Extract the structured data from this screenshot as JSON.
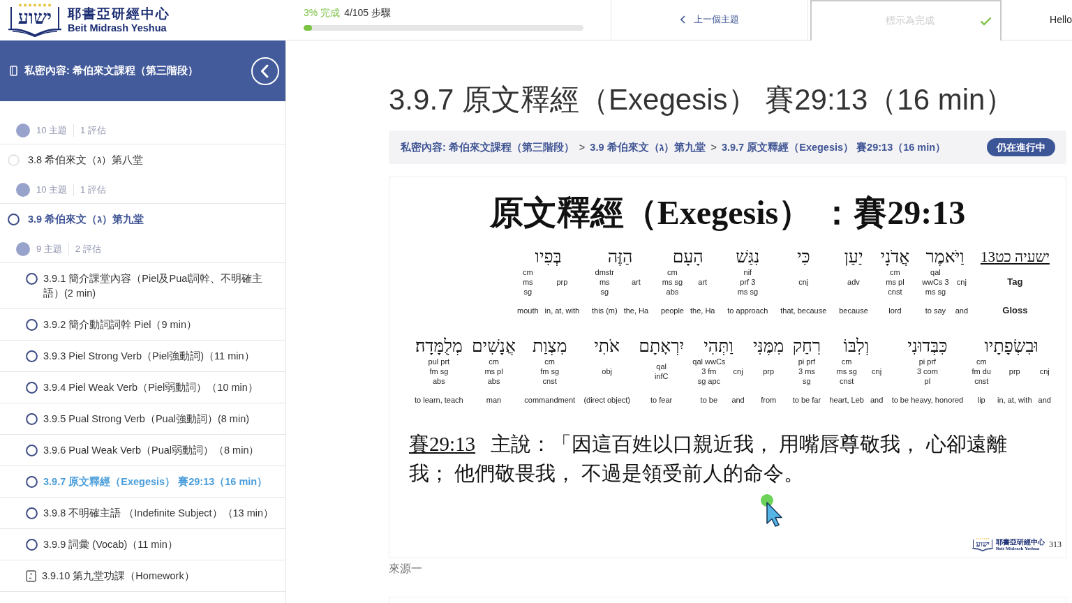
{
  "logo": {
    "mark": "ישוע",
    "name": "耶書亞研經中心",
    "subtitle": "Beit Midrash Yeshua"
  },
  "topbar": {
    "progress": {
      "percent": "3% 完成",
      "steps": "4/105 步驟",
      "level": 0.03
    },
    "prev_button": {
      "label": "上一個主題"
    },
    "complete_button": {
      "label": "標示為完成",
      "disabled": true
    },
    "user": {
      "greeting": "Hello"
    }
  },
  "sidebar": {
    "header": {
      "title": "私密內容: 希伯來文課程（第三階段）"
    },
    "lessons": [
      {
        "topics_count": "10 主題",
        "assessments_count": "1 評估"
      },
      {
        "title": "3.8 希伯來文（ג）第八堂",
        "selected": false,
        "topics_count": "10 主題",
        "assessments_count": "1 評估"
      },
      {
        "title": "3.9 希伯來文（ג）第九堂",
        "selected": true,
        "topics_count": "9 主題",
        "assessments_count": "2 評估",
        "topics": [
          {
            "kind": "lesson",
            "label": "3.9.1 簡介課堂內容（Piel及Pual詞幹、不明確主語）(2 min)",
            "selected": false
          },
          {
            "kind": "lesson",
            "label": "3.9.2 簡介動詞詞幹 Piel（9 min）",
            "selected": false
          },
          {
            "kind": "lesson",
            "label": "3.9.3 Piel Strong Verb（Piel強動詞)（11 min）",
            "selected": false
          },
          {
            "kind": "lesson",
            "label": "3.9.4 Piel Weak Verb（Piel弱動詞）（10 min）",
            "selected": false
          },
          {
            "kind": "lesson",
            "label": "3.9.5 Pual Strong Verb（Pual強動詞）(8 min)",
            "selected": false
          },
          {
            "kind": "lesson",
            "label": "3.9.6 Pual Weak Verb（Pual弱動詞）（8 min）",
            "selected": false
          },
          {
            "kind": "lesson",
            "label": "3.9.7 原文釋經（Exegesis） 賽29:13（16 min）",
            "selected": true
          },
          {
            "kind": "lesson",
            "label": "3.9.8 不明確主語 （Indefinite Subject）（13 min）",
            "selected": false
          },
          {
            "kind": "lesson",
            "label": "3.9.9 詞彙 (Vocab)（11 min）",
            "selected": false
          },
          {
            "kind": "homework",
            "label": "3.9.10 第九堂功課（Homework）",
            "selected": false
          }
        ]
      }
    ]
  },
  "main": {
    "title": "3.9.7 原文釋經（Exegesis） 賽29:13（16 min）",
    "breadcrumbs": [
      {
        "kind": "link",
        "label": "私密內容: 希伯來文課程（第三階段）"
      },
      {
        "kind": "separator",
        "label": ">"
      },
      {
        "kind": "link",
        "label": "3.9 希伯來文（ג）第九堂"
      },
      {
        "kind": "separator",
        "label": ">"
      },
      {
        "kind": "link",
        "label": "3.9.7 原文釋經（Exegesis） 賽29:13（16 min）"
      }
    ],
    "status_badge": "仍在進行中",
    "slide": {
      "title": "原文釋經（Exegesis） ：賽29:13",
      "interlinear": [
        {
          "label": {
            "reference": "ישעיה כט13",
            "tag": "Tag",
            "gloss": "Gloss"
          },
          "hebrew": [
            "וַיֹּאמֶר",
            "אֲדֹנָי",
            "יַעַן",
            "כִּי",
            "נִגַּשׁ",
            "הָעָם",
            "הַזֶּה",
            "בְּפִיו"
          ],
          "words": [
            {
              "parts": [
                {
                  "tag": [
                    "cm",
                    "ms",
                    "sg"
                  ],
                  "gloss": "mouth"
                },
                {
                  "tag": [
                    "prp"
                  ],
                  "gloss": "in, at, with"
                }
              ]
            },
            {
              "parts": [
                {
                  "tag": [
                    "dmstr",
                    "ms",
                    "sg"
                  ],
                  "gloss": "this (m)"
                },
                {
                  "tag": [
                    "art"
                  ],
                  "gloss": "the, Ha"
                }
              ]
            },
            {
              "parts": [
                {
                  "tag": [
                    "cm",
                    "ms sg",
                    "abs"
                  ],
                  "gloss": "people"
                },
                {
                  "tag": [
                    "art"
                  ],
                  "gloss": "the, Ha"
                }
              ]
            },
            {
              "parts": [
                {
                  "tag": [
                    "nif",
                    "prf 3",
                    "ms sg"
                  ],
                  "gloss": "to approach"
                }
              ]
            },
            {
              "parts": [
                {
                  "tag": [
                    "cnj"
                  ],
                  "gloss": "that, because"
                }
              ]
            },
            {
              "parts": [
                {
                  "tag": [
                    "adv"
                  ],
                  "gloss": "because"
                }
              ]
            },
            {
              "parts": [
                {
                  "tag": [
                    "cm",
                    "ms pl",
                    "cnst"
                  ],
                  "gloss": "lord"
                }
              ]
            },
            {
              "parts": [
                {
                  "tag": [
                    "qal",
                    "wwCs 3",
                    "ms sg"
                  ],
                  "gloss": "to say"
                },
                {
                  "tag": [
                    "cnj"
                  ],
                  "gloss": "and"
                }
              ]
            }
          ]
        },
        {
          "hebrew": [
            "וּבִשְׂפָתָיו",
            "כִּבְּדוּנִי",
            "וְלִבּוֹ",
            "רִחַק",
            "מִמֶּנִּי",
            "וַתְּהִי",
            "יִרְאָתָם",
            "אֹתִי",
            "מִצְוַת",
            "אֲנָשִׁים",
            "מְלֻמָּדָה׃"
          ],
          "words": [
            {
              "parts": [
                {
                  "tag": [
                    "pul prt",
                    "fm sg",
                    "abs"
                  ],
                  "gloss": "to learn, teach"
                }
              ]
            },
            {
              "parts": [
                {
                  "tag": [
                    "cm",
                    "ms pl",
                    "abs"
                  ],
                  "gloss": "man"
                }
              ]
            },
            {
              "parts": [
                {
                  "tag": [
                    "cm",
                    "fm sg",
                    "cnst"
                  ],
                  "gloss": "commandment"
                }
              ]
            },
            {
              "parts": [
                {
                  "tag": [
                    "obj"
                  ],
                  "gloss": "(direct object)"
                }
              ]
            },
            {
              "parts": [
                {
                  "tag": [
                    "qal",
                    "infC"
                  ],
                  "gloss": "to fear"
                }
              ]
            },
            {
              "parts": [
                {
                  "tag": [
                    "qal wwCs",
                    "3 fm",
                    "sg apc"
                  ],
                  "gloss": "to be"
                },
                {
                  "tag": [
                    "cnj"
                  ],
                  "gloss": "and"
                }
              ]
            },
            {
              "parts": [
                {
                  "tag": [
                    "prp"
                  ],
                  "gloss": "from"
                }
              ]
            },
            {
              "parts": [
                {
                  "tag": [
                    "pi prf",
                    "3 ms",
                    "sg"
                  ],
                  "gloss": "to be far"
                }
              ]
            },
            {
              "parts": [
                {
                  "tag": [
                    "cm",
                    "ms sg",
                    "cnst"
                  ],
                  "gloss": "heart, Leb"
                },
                {
                  "tag": [
                    "cnj"
                  ],
                  "gloss": "and"
                }
              ]
            },
            {
              "parts": [
                {
                  "tag": [
                    "pi prf",
                    "3 com",
                    "pl"
                  ],
                  "gloss": "to be heavy, honored"
                }
              ]
            },
            {
              "parts": [
                {
                  "tag": [
                    "cm",
                    "fm du",
                    "cnst"
                  ],
                  "gloss": "lip"
                },
                {
                  "tag": [
                    "prp"
                  ],
                  "gloss": "in, at, with"
                },
                {
                  "tag": [
                    "cnj"
                  ],
                  "gloss": "and"
                }
              ]
            }
          ]
        }
      ],
      "verse": {
        "reference": "賽29:13",
        "text": "主說：「因這百姓以口親近我， 用嘴唇尊敬我， 心卻遠離我； 他們敬畏我， 不過是領受前人的命令。"
      },
      "footer": {
        "mark": "ישוע",
        "name": "耶書亞研經中心",
        "subtitle": "Beit Midrash Yeshua",
        "page": "313"
      }
    },
    "source_label": "來源一"
  }
}
